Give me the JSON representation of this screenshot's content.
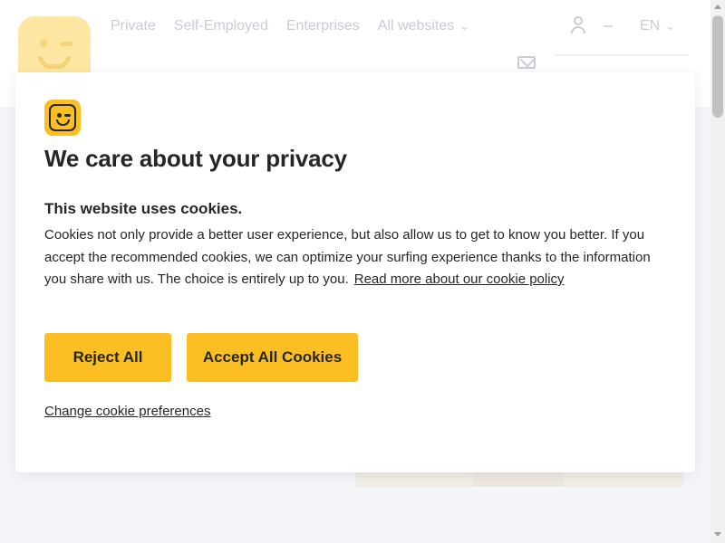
{
  "background": {
    "nav": [
      "Private",
      "Self-Employed",
      "Enterprises",
      "All websites"
    ],
    "language": "EN"
  },
  "dialog": {
    "title": "We care about your privacy",
    "subheading": "This website uses cookies.",
    "body": "Cookies not only provide a better user experience, but also allow us to get to know you better. If you accept the recommended cookies, we can optimize your surfing experience thanks to the information you share with us. The choice is entirely up to you.",
    "policy_link": "Read more about our cookie policy",
    "reject_label": "Reject All",
    "accept_label": "Accept All Cookies",
    "preferences_link": "Change cookie preferences"
  },
  "colors": {
    "accent": "#fbbf24",
    "text": "#262626",
    "page_background": "#f4f5f9"
  },
  "icons": [
    "brand-logo",
    "user-icon",
    "mail-icon",
    "chevron-down-icon"
  ]
}
